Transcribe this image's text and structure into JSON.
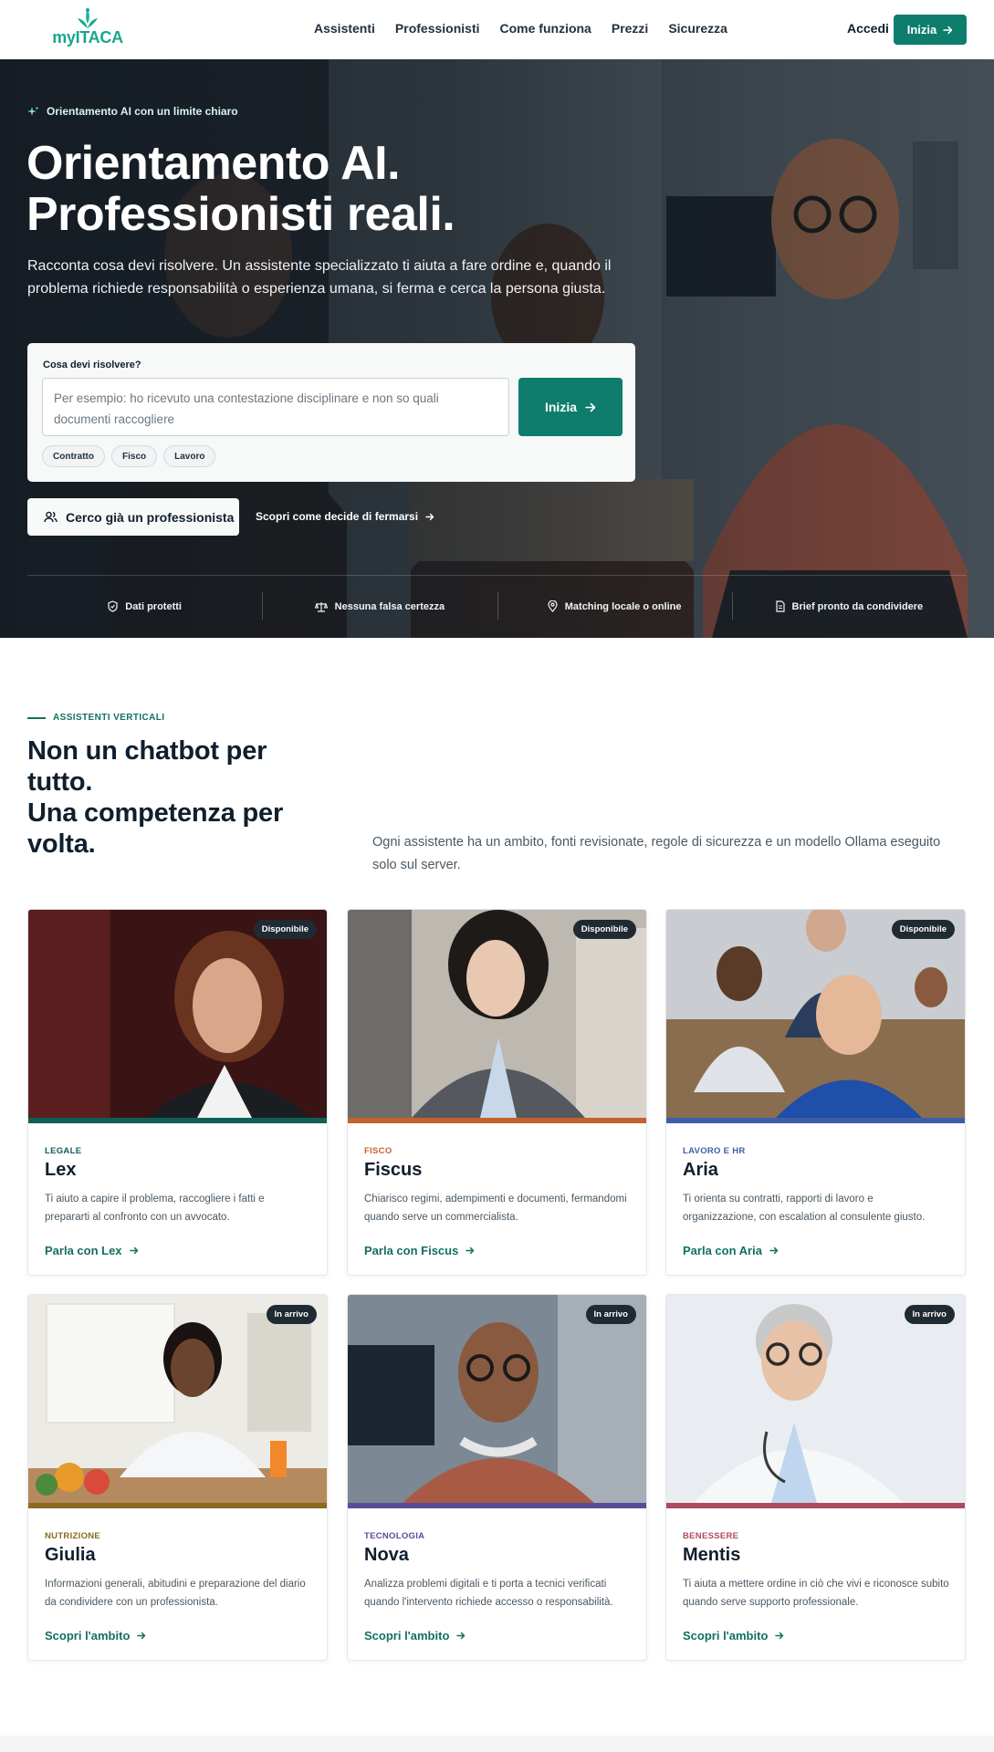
{
  "nav": {
    "logo_text": "myITACA",
    "links": [
      "Assistenti",
      "Professionisti",
      "Come funziona",
      "Prezzi",
      "Sicurezza"
    ],
    "login": "Accedi",
    "cta": "Inizia"
  },
  "hero": {
    "eyebrow": "Orientamento AI con un limite chiaro",
    "title_line1": "Orientamento AI.",
    "title_line2": "Professionisti reali.",
    "subtitle": "Racconta cosa devi risolvere. Un assistente specializzato ti aiuta a fare ordine e, quando il problema richiede responsabilità o esperienza umana, si ferma e cerca la persona giusta.",
    "ask": {
      "label": "Cosa devi risolvere?",
      "placeholder": "Per esempio: ho ricevuto una contestazione disciplinare e non so quali documenti raccogliere",
      "button": "Inizia",
      "chips": [
        "Contratto",
        "Fisco",
        "Lavoro"
      ]
    },
    "pro_button": "Cerco già un professionista",
    "how_link": "Scopri come decide di fermarsi",
    "trust": [
      "Dati protetti",
      "Nessuna falsa certezza",
      "Matching locale o online",
      "Brief pronto da condividere"
    ]
  },
  "section": {
    "eyebrow": "ASSISTENTI VERTICALI",
    "title_line1": "Non un chatbot per",
    "title_line2": "tutto.",
    "title_line3": "Una competenza per",
    "title_line4": "volta.",
    "description": "Ogni assistente ha un ambito, fonti revisionate, regole di sicurezza e un modello Ollama eseguito solo sul server."
  },
  "cards": [
    {
      "badge": "Disponibile",
      "category": "LEGALE",
      "name": "Lex",
      "description": "Ti aiuto a capire il problema, raccogliere i fatti e prepararti al confronto con un avvocato.",
      "link": "Parla con Lex",
      "accent": "#0f5f55"
    },
    {
      "badge": "Disponibile",
      "category": "FISCO",
      "name": "Fiscus",
      "description": "Chiarisco regimi, adempimenti e documenti, fermandomi quando serve un commercialista.",
      "link": "Parla con Fiscus",
      "accent": "#c4622d"
    },
    {
      "badge": "Disponibile",
      "category": "LAVORO E HR",
      "name": "Aria",
      "description": "Ti orienta su contratti, rapporti di lavoro e organizzazione, con escalation al consulente giusto.",
      "link": "Parla con Aria",
      "accent": "#3f5ea8"
    },
    {
      "badge": "In arrivo",
      "category": "NUTRIZIONE",
      "name": "Giulia",
      "description": "Informazioni generali, abitudini e preparazione del diario da condividere con un professionista.",
      "link": "Scopri l'ambito",
      "accent": "#8a6a1f"
    },
    {
      "badge": "In arrivo",
      "category": "TECNOLOGIA",
      "name": "Nova",
      "description": "Analizza problemi digitali e ti porta a tecnici verificati quando l'intervento richiede accesso o responsabilità.",
      "link": "Scopri l'ambito",
      "accent": "#5a4b9a"
    },
    {
      "badge": "In arrivo",
      "category": "BENESSERE",
      "name": "Mentis",
      "description": "Ti aiuta a mettere ordine in ciò che vivi e riconosce subito quando serve supporto professionale.",
      "link": "Scopri l'ambito",
      "accent": "#b04a5e"
    }
  ],
  "colors": {
    "brand": "#0e7d6d",
    "brand_text": "#12705f",
    "dark": "#0f1f2e"
  }
}
